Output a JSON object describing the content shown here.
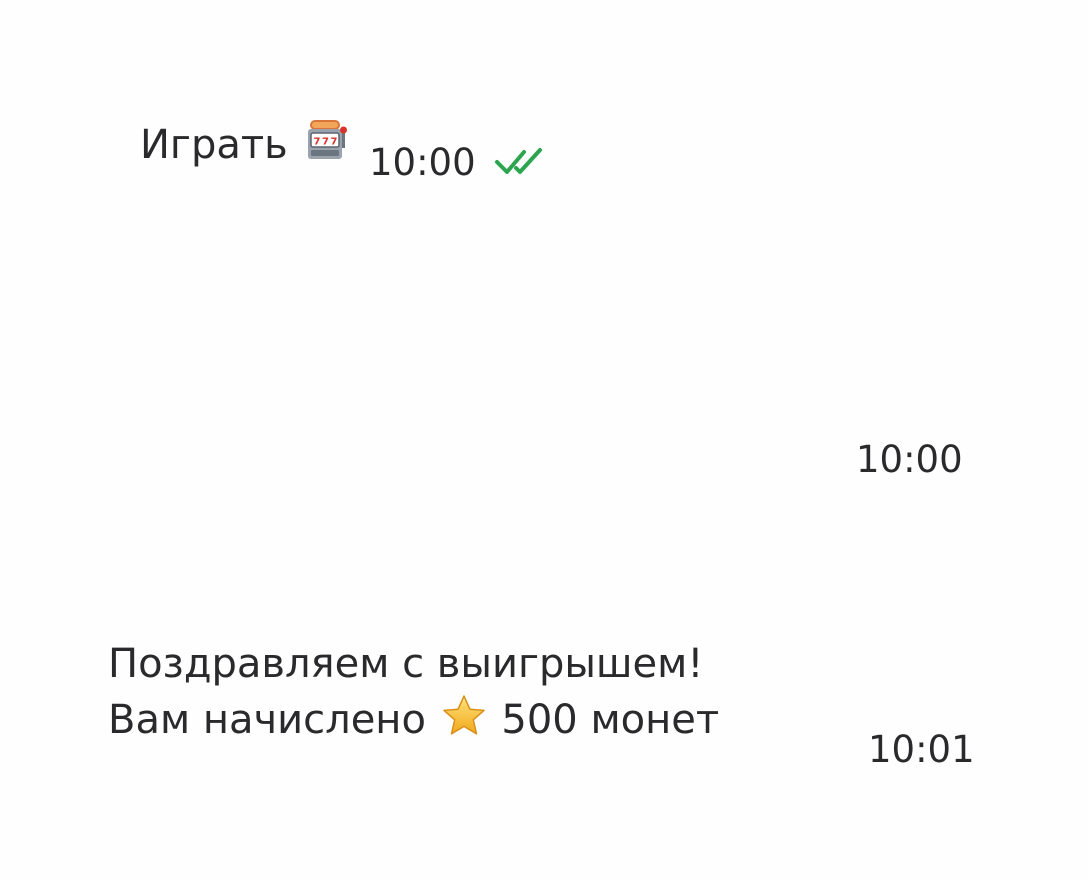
{
  "colors": {
    "background": "#fefefe",
    "text": "#2a2a2c",
    "read_ticks": "#2ca54e",
    "star_fill": "#f7c22b"
  },
  "messages": [
    {
      "direction": "outgoing",
      "text": "Играть",
      "emoji_icon": "slot-machine-icon",
      "time": "10:00",
      "status_icon": "double-check-icon"
    },
    {
      "direction": "incoming",
      "time": "10:00"
    },
    {
      "direction": "incoming",
      "line1": "Поздравляем с выигрышем!",
      "line2_prefix": "Вам начислено",
      "emoji_icon": "star-icon",
      "line2_suffix": "500 монет",
      "time": "10:01"
    }
  ]
}
